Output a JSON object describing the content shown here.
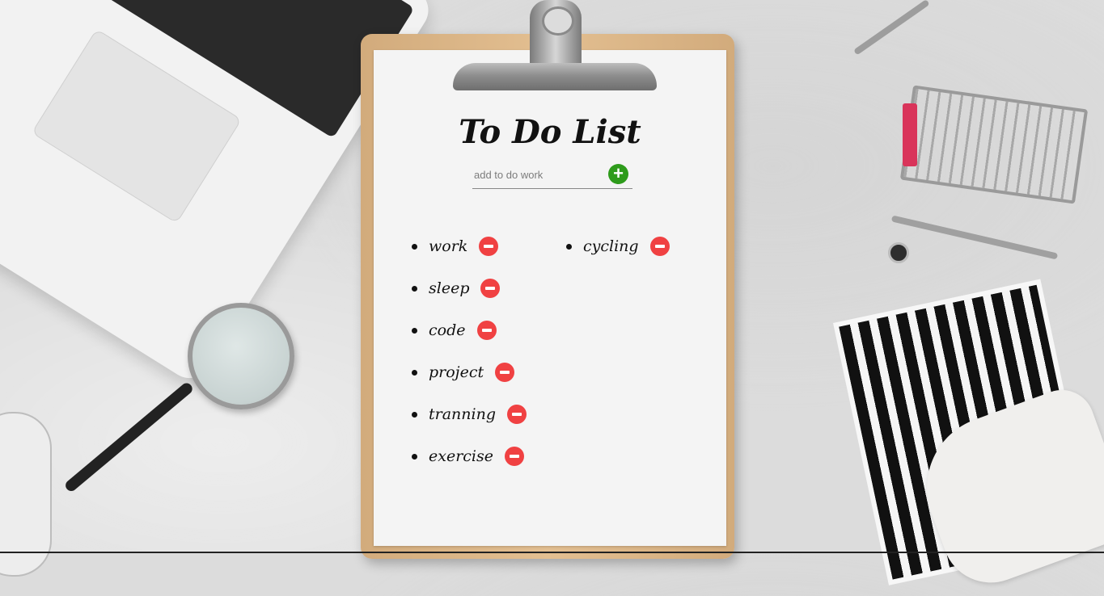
{
  "app": {
    "title": "To Do List"
  },
  "input": {
    "placeholder": "add to do work",
    "value": "",
    "add_icon": "plus-circle-icon",
    "add_label": "+"
  },
  "todos": [
    {
      "text": "work"
    },
    {
      "text": "sleep"
    },
    {
      "text": "code"
    },
    {
      "text": "project"
    },
    {
      "text": "tranning"
    },
    {
      "text": "exercise"
    },
    {
      "text": "cycling"
    }
  ],
  "colors": {
    "add_button": "#2e9b1b",
    "remove_button": "#f04142",
    "paper": "#f4f4f4",
    "board": "#dcb584"
  }
}
